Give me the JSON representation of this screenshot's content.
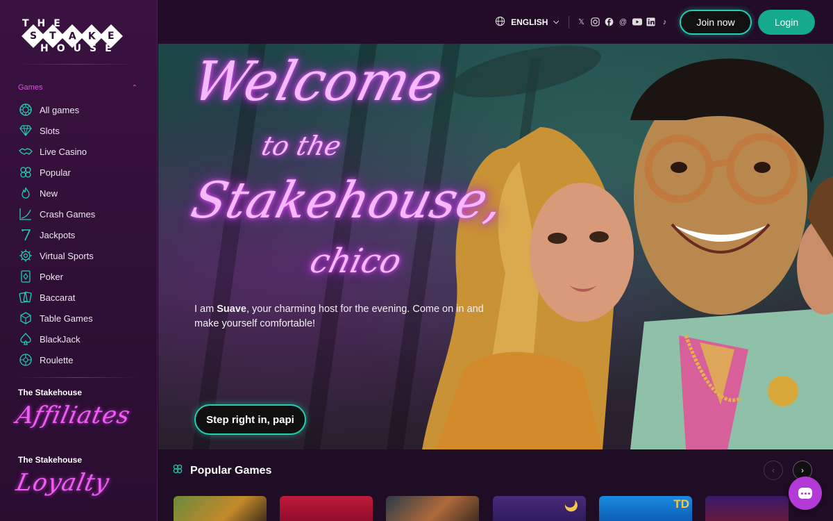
{
  "brand": {
    "logo_top": "THE",
    "logo_middle": [
      "S",
      "T",
      "A",
      "K",
      "E"
    ],
    "logo_bottom": "HOUSE"
  },
  "sidebar": {
    "section_label": "Games",
    "items": [
      {
        "label": "All games",
        "icon": "chip-icon"
      },
      {
        "label": "Slots",
        "icon": "diamond-icon"
      },
      {
        "label": "Live Casino",
        "icon": "handshake-icon"
      },
      {
        "label": "Popular",
        "icon": "clover-icon"
      },
      {
        "label": "New",
        "icon": "flame-icon"
      },
      {
        "label": "Crash Games",
        "icon": "chart-icon"
      },
      {
        "label": "Jackpots",
        "icon": "seven-icon"
      },
      {
        "label": "Virtual Sports",
        "icon": "gear-icon"
      },
      {
        "label": "Poker",
        "icon": "card-icon"
      },
      {
        "label": "Baccarat",
        "icon": "cards-icon"
      },
      {
        "label": "Table Games",
        "icon": "dice-icon"
      },
      {
        "label": "BlackJack",
        "icon": "spade-icon"
      },
      {
        "label": "Roulette",
        "icon": "roulette-icon"
      }
    ],
    "affiliates_title": "The Stakehouse",
    "affiliates_script": "Affiliates",
    "loyalty_title": "The Stakehouse",
    "loyalty_script": "Loyalty"
  },
  "topbar": {
    "language": "ENGLISH",
    "socials": [
      "x-icon",
      "instagram-icon",
      "facebook-icon",
      "threads-icon",
      "youtube-icon",
      "linkedin-icon",
      "tiktok-icon"
    ],
    "join_label": "Join now",
    "login_label": "Login"
  },
  "hero": {
    "line1": "Welcome",
    "line2": "to the",
    "line3": "Stakehouse,",
    "line4": "chico",
    "text_pre": "I am ",
    "text_bold": "Suave",
    "text_post": ", your charming host for the evening. Come on in and make yourself comfortable!",
    "cta_label": "Step right in, papi"
  },
  "popular": {
    "title": "Popular Games",
    "card_badge": "TD"
  },
  "colors": {
    "accent_teal": "#1fd1b0",
    "accent_pink": "#e24fe6",
    "sidebar_bg": "#2e0f35"
  }
}
